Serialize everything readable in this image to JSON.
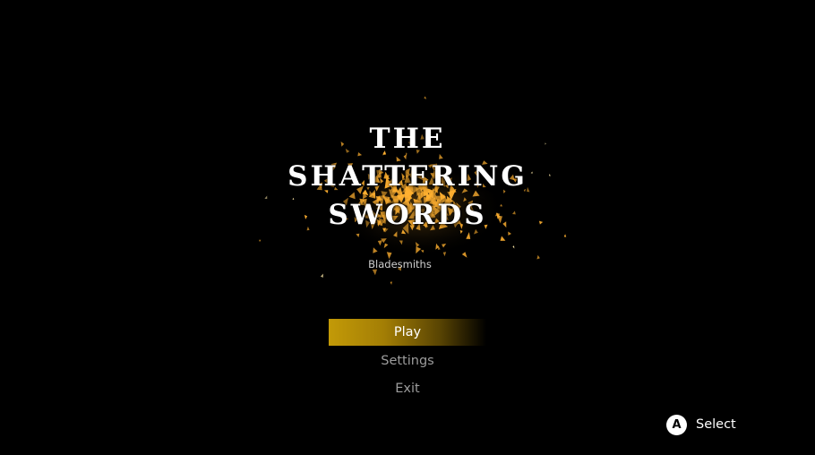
{
  "title": {
    "line1": "THE",
    "line2": "SHATTERING",
    "line3": "SWORDS"
  },
  "studio": "Bladesmiths",
  "menu": {
    "items": [
      {
        "label": "Play",
        "selected": true
      },
      {
        "label": "Settings",
        "selected": false
      },
      {
        "label": "Exit",
        "selected": false
      }
    ]
  },
  "hint": {
    "button": "A",
    "label": "Select"
  },
  "colors": {
    "background": "#000000",
    "spark_core": "#ffb030",
    "spark_edge": "#ffe9a8",
    "menu_highlight": "#c39a07"
  }
}
